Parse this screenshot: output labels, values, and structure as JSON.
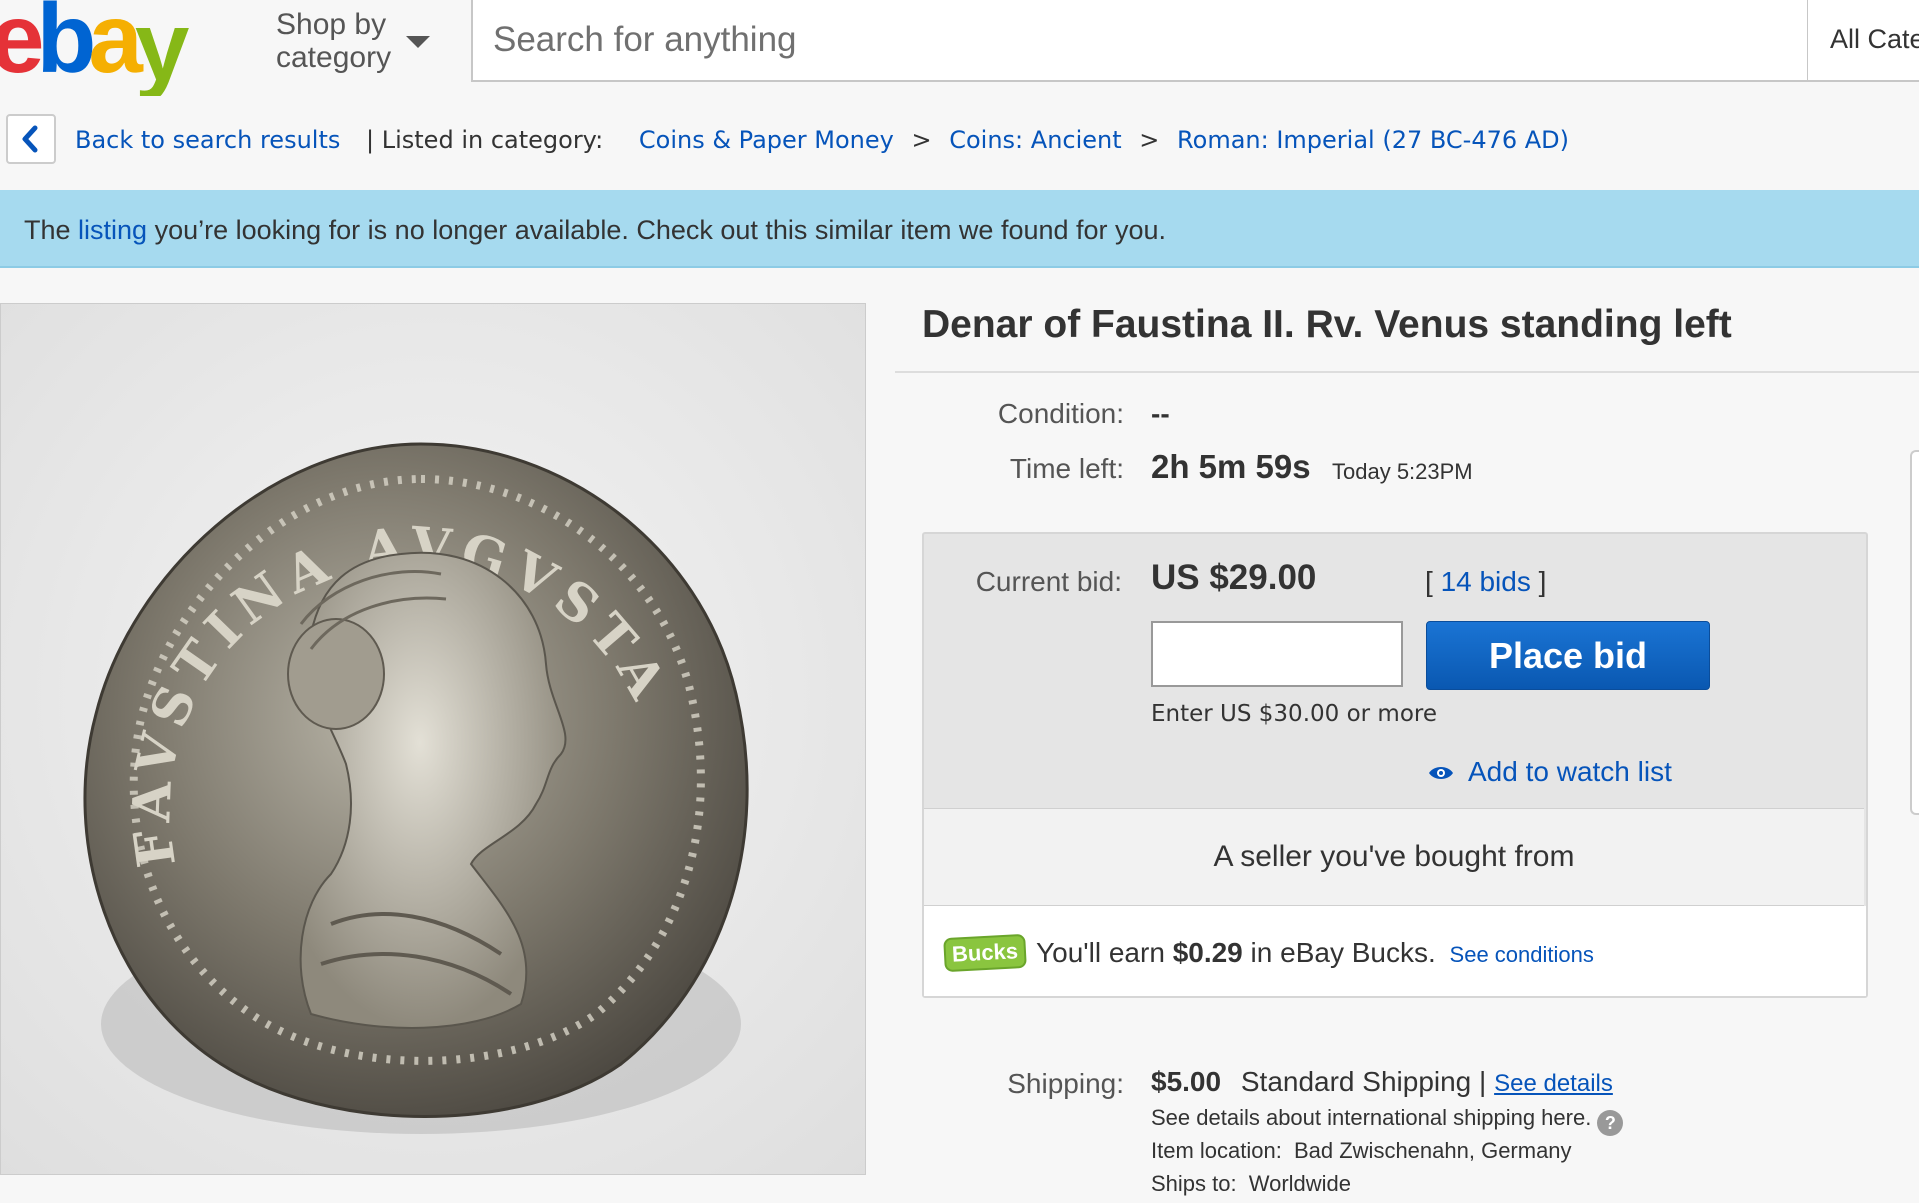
{
  "header": {
    "shop_by_category": "Shop by category",
    "search_placeholder": "Search for anything",
    "category_select": "All Cate"
  },
  "breadcrumb": {
    "back_label": "Back to search results",
    "listed_in": "| Listed in category:",
    "items": [
      "Coins & Paper Money",
      "Coins: Ancient",
      "Roman: Imperial (27 BC-476 AD)"
    ],
    "separator": ">"
  },
  "banner": {
    "prefix": "The ",
    "link": "listing",
    "suffix": " you’re looking for is no longer available. Check out this similar item we found for you."
  },
  "item": {
    "title": "Denar of Faustina II. Rv. Venus standing left",
    "condition_label": "Condition:",
    "condition_value": "--",
    "time_left_label": "Time left:",
    "time_left_value": "2h 5m 59s",
    "end_time": "Today 5:23PM",
    "current_bid_label": "Current bid:",
    "current_bid_value": "US $29.00",
    "bids_open": "[ ",
    "bids_link": "14 bids",
    "bids_close": " ]",
    "place_bid_label": "Place bid",
    "min_bid_hint": "Enter US $30.00 or more",
    "watch_label": "Add to watch list",
    "seller_note": "A seller you've bought from",
    "bucks_badge": "Bucks",
    "bucks_prefix": "You'll earn ",
    "bucks_amount": "$0.29",
    "bucks_suffix": " in eBay Bucks.",
    "bucks_link": "See conditions"
  },
  "shipping": {
    "label": "Shipping:",
    "cost": "$5.00",
    "method": "Standard Shipping",
    "separator": "|",
    "details_link": "See details",
    "intl_note": "See details about international shipping here.",
    "location_label": "Item location:",
    "location_value": "Bad Zwischenahn, Germany",
    "ships_to_label": "Ships to:",
    "ships_to_value": "Worldwide"
  },
  "coin": {
    "legend": "FAVSTINA AVGVSTA"
  },
  "colors": {
    "link": "#0654ba",
    "banner": "#a6daef",
    "place_bid": "#0d67c7",
    "bucks": "#8ac53f",
    "logo_e": "#e53238",
    "logo_b": "#0064d2",
    "logo_a": "#f5af02",
    "logo_y": "#86b817"
  }
}
